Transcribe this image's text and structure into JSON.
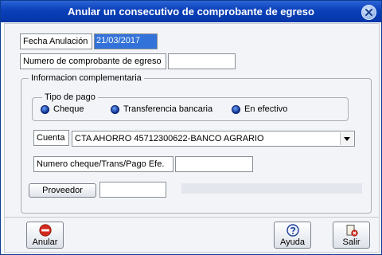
{
  "window": {
    "title": "Anular un consecutivo de comprobante de egreso"
  },
  "fields": {
    "fecha_label": "Fecha Anulación",
    "fecha_value": "21/03/2017",
    "numero_label": "Numero de comprobante de egreso",
    "numero_value": ""
  },
  "info": {
    "group_title": "Informacion complementaria",
    "tipo_pago": {
      "title": "Tipo de pago",
      "options": [
        "Cheque",
        "Transferencia bancaria",
        "En efectivo"
      ]
    },
    "cuenta_label": "Cuenta",
    "cuenta_value": "CTA AHORRO 45712300622-BANCO AGRARIO",
    "numero_cheque_label": "Numero cheque/Trans/Pago Efe.",
    "numero_cheque_value": "",
    "proveedor_button": "Proveedor",
    "proveedor_value": ""
  },
  "buttons": {
    "anular": "Anular",
    "ayuda": "Ayuda",
    "salir": "Salir"
  }
}
